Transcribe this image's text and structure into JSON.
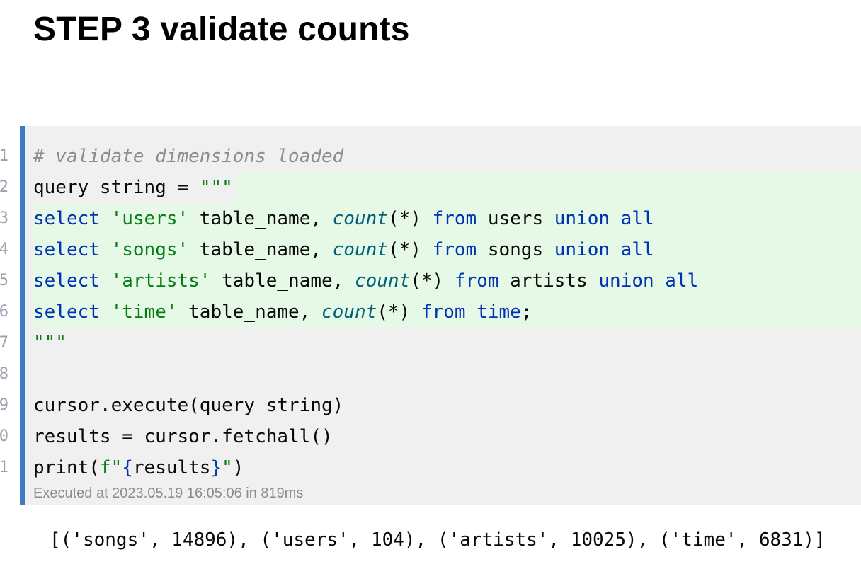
{
  "heading": "STEP 3 validate counts",
  "colors": {
    "accent_bar": "#3d7ac6",
    "keyword": "#0033b3",
    "string": "#067d17",
    "function": "#00627a",
    "comment": "#8c8c8c",
    "highlight": "#e6f9e6"
  },
  "code": {
    "line_numbers": [
      "1",
      "2",
      "3",
      "4",
      "5",
      "6",
      "7",
      "8",
      "9",
      "0",
      "1"
    ],
    "lines": [
      {
        "tokens": [
          {
            "t": "# validate dimensions loaded",
            "k": "com"
          }
        ]
      },
      {
        "tokens": [
          {
            "t": "query_string = ",
            "k": "plain"
          },
          {
            "t": "\"\"\"",
            "k": "str"
          }
        ]
      },
      {
        "tokens": [
          {
            "t": "select",
            "k": "kw"
          },
          {
            "t": " ",
            "k": "plain"
          },
          {
            "t": "'users'",
            "k": "str"
          },
          {
            "t": " table_name, ",
            "k": "plain"
          },
          {
            "t": "count",
            "k": "fn"
          },
          {
            "t": "(*) ",
            "k": "plain"
          },
          {
            "t": "from",
            "k": "kw"
          },
          {
            "t": " users ",
            "k": "plain"
          },
          {
            "t": "union all",
            "k": "kw"
          }
        ]
      },
      {
        "tokens": [
          {
            "t": "select",
            "k": "kw"
          },
          {
            "t": " ",
            "k": "plain"
          },
          {
            "t": "'songs'",
            "k": "str"
          },
          {
            "t": " table_name, ",
            "k": "plain"
          },
          {
            "t": "count",
            "k": "fn"
          },
          {
            "t": "(*) ",
            "k": "plain"
          },
          {
            "t": "from",
            "k": "kw"
          },
          {
            "t": " songs ",
            "k": "plain"
          },
          {
            "t": "union all",
            "k": "kw"
          }
        ]
      },
      {
        "tokens": [
          {
            "t": "select",
            "k": "kw"
          },
          {
            "t": " ",
            "k": "plain"
          },
          {
            "t": "'artists'",
            "k": "str"
          },
          {
            "t": " table_name, ",
            "k": "plain"
          },
          {
            "t": "count",
            "k": "fn"
          },
          {
            "t": "(*) ",
            "k": "plain"
          },
          {
            "t": "from",
            "k": "kw"
          },
          {
            "t": " artists ",
            "k": "plain"
          },
          {
            "t": "union all",
            "k": "kw"
          }
        ]
      },
      {
        "tokens": [
          {
            "t": "select",
            "k": "kw"
          },
          {
            "t": " ",
            "k": "plain"
          },
          {
            "t": "'time'",
            "k": "str"
          },
          {
            "t": " table_name, ",
            "k": "plain"
          },
          {
            "t": "count",
            "k": "fn"
          },
          {
            "t": "(*) ",
            "k": "plain"
          },
          {
            "t": "from time",
            "k": "kw"
          },
          {
            "t": ";",
            "k": "plain"
          }
        ]
      },
      {
        "tokens": [
          {
            "t": "\"\"\"",
            "k": "str"
          }
        ]
      },
      {
        "tokens": []
      },
      {
        "tokens": [
          {
            "t": "cursor.execute(query_string)",
            "k": "plain"
          }
        ]
      },
      {
        "tokens": [
          {
            "t": "results = cursor.fetchall()",
            "k": "plain"
          }
        ]
      },
      {
        "tokens": [
          {
            "t": "print(",
            "k": "plain"
          },
          {
            "t": "f\"",
            "k": "str"
          },
          {
            "t": "{",
            "k": "brace"
          },
          {
            "t": "results",
            "k": "plain"
          },
          {
            "t": "}",
            "k": "brace"
          },
          {
            "t": "\"",
            "k": "str"
          },
          {
            "t": ")",
            "k": "plain"
          }
        ]
      }
    ]
  },
  "execution_status": "Executed at 2023.05.19 16:05:06 in 819ms",
  "output": "[('songs', 14896), ('users', 104), ('artists', 10025), ('time', 6831)]"
}
